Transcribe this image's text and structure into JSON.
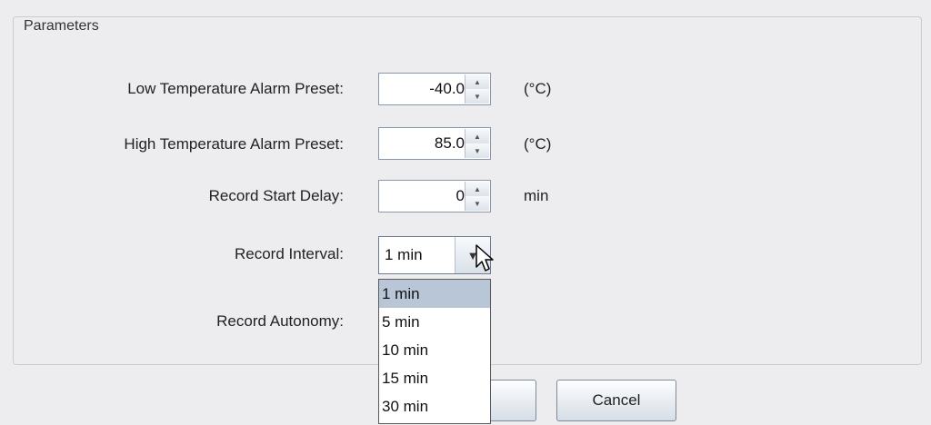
{
  "parameters": {
    "title": "Parameters",
    "low_alarm": {
      "label": "Low Temperature Alarm Preset:",
      "value": "-40.0",
      "unit": "(°C)"
    },
    "high_alarm": {
      "label": "High Temperature Alarm Preset:",
      "value": "85.0",
      "unit": "(°C)"
    },
    "start_delay": {
      "label": "Record Start Delay:",
      "value": "0",
      "unit": "min"
    },
    "interval": {
      "label": "Record Interval:",
      "value": "1 min",
      "options": [
        "1 min",
        "5 min",
        "10 min",
        "15 min",
        "30 min"
      ]
    },
    "autonomy": {
      "label": "Record Autonomy:"
    }
  },
  "buttons": {
    "cancel_label": "Cancel"
  },
  "icons": {
    "spinner_up": "spin-up-arrow-icon",
    "spinner_down": "spin-down-arrow-icon",
    "combo_arrow": "chevron-down-icon",
    "cursor": "mouse-pointer-icon"
  }
}
